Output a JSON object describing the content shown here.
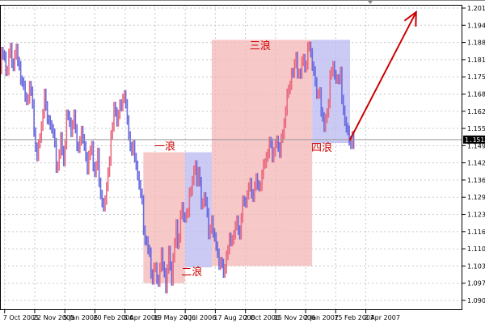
{
  "chart_data": {
    "type": "line",
    "price_range": [
      1.0905,
      1.201
    ],
    "y_ticks": [
      "1.2010",
      "1.1945",
      "1.1880",
      "1.1815",
      "1.1750",
      "1.1685",
      "1.1620",
      "1.1555",
      "1.1490",
      "1.1425",
      "1.1360",
      "1.1295",
      "1.1230",
      "1.1165",
      "1.1100",
      "1.1035",
      "1.0970",
      "1.0905"
    ],
    "x_ticks": [
      "7 Oct 2005",
      "22 Nov 2005",
      "5 Jan 2006",
      "20 Feb 2006",
      "5 Apr 2006",
      "19 May 2006",
      "4 Jul 2006",
      "17 Aug 2006",
      "2 Oct 2006",
      "15 Nov 2006",
      "2 Jan 2007",
      "15 Feb 2007",
      "2 Apr 2007"
    ],
    "current_price": "1.1513",
    "grid": true,
    "series": [
      {
        "values": [
          1.18,
          1.186,
          1.175,
          1.188,
          1.183,
          1.19,
          1.178,
          1.17,
          1.165,
          1.172,
          1.16,
          1.15,
          1.16,
          1.168,
          1.16,
          1.158,
          1.15,
          1.143,
          1.155,
          1.148,
          1.163,
          1.155,
          1.162,
          1.15,
          1.158,
          1.155,
          1.145,
          1.15,
          1.14,
          1.146,
          1.134,
          1.13,
          1.145,
          1.153,
          1.165,
          1.158,
          1.17,
          1.175,
          1.16,
          1.15,
          1.146,
          1.135,
          1.128,
          1.12,
          1.115,
          1.105,
          1.102,
          1.097,
          1.108,
          1.098,
          1.115,
          1.102,
          1.12,
          1.11,
          1.128,
          1.12,
          1.132,
          1.14,
          1.145,
          1.138,
          1.125,
          1.13,
          1.118,
          1.125,
          1.115,
          1.108,
          1.102,
          1.105,
          1.112,
          1.118,
          1.125,
          1.12,
          1.13,
          1.126,
          1.135,
          1.132,
          1.14,
          1.137,
          1.145,
          1.142,
          1.15,
          1.146,
          1.155,
          1.152,
          1.16,
          1.165,
          1.172,
          1.178,
          1.183,
          1.18,
          1.186,
          1.182,
          1.188,
          1.177,
          1.168,
          1.172,
          1.16,
          1.165,
          1.175,
          1.18,
          1.172,
          1.176,
          1.165,
          1.16,
          1.155,
          1.15
        ],
        "color_up": "#e86a80",
        "color_down": "#6a6adf"
      }
    ],
    "wave_boxes": [
      {
        "kind": "impulse",
        "color": "#f4b6b6",
        "from": 0.31,
        "to": 0.4,
        "low": 1.097,
        "high": 1.1465
      },
      {
        "kind": "correction",
        "color": "#b8b8f0",
        "from": 0.4,
        "to": 0.458,
        "low": 1.103,
        "high": 1.1465
      },
      {
        "kind": "impulse",
        "color": "#f4b6b6",
        "from": 0.458,
        "to": 0.675,
        "low": 1.1035,
        "high": 1.189
      },
      {
        "kind": "correction",
        "color": "#b8b8f0",
        "from": 0.675,
        "to": 0.757,
        "low": 1.15,
        "high": 1.189
      }
    ],
    "forecast_arrow": {
      "from_price": 1.151,
      "to_price": 1.1995,
      "color": "#cc0000"
    },
    "annotations": [
      {
        "text": "一浪",
        "price": 1.1475,
        "at": 0.334
      },
      {
        "text": "二浪",
        "price": 1.1,
        "at": 0.392
      },
      {
        "text": "三浪",
        "price": 1.1855,
        "at": 0.54
      },
      {
        "text": "四浪",
        "price": 1.147,
        "at": 0.673
      }
    ]
  }
}
